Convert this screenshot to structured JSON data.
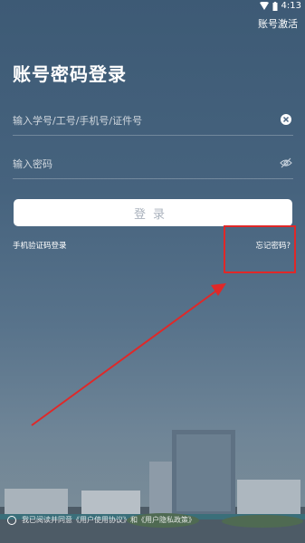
{
  "status_bar": {
    "time": "4:13"
  },
  "header": {
    "activate_label": "账号激活"
  },
  "page": {
    "title": "账号密码登录"
  },
  "form": {
    "account_placeholder": "输入学号/工号/手机号/证件号",
    "password_placeholder": "输入密码",
    "login_label": "登录"
  },
  "links": {
    "sms_login": "手机验证码登录",
    "forgot_password": "忘记密码?"
  },
  "agreement": {
    "text": "我已阅读并同意《用户使用协议》和《用户隐私政策》"
  },
  "icons": {
    "clear": "clear-icon",
    "eye": "eye-off-icon",
    "wifi": "wifi-icon",
    "battery": "battery-icon"
  },
  "colors": {
    "annotation": "#e02828",
    "button_text": "#aab2bd"
  }
}
